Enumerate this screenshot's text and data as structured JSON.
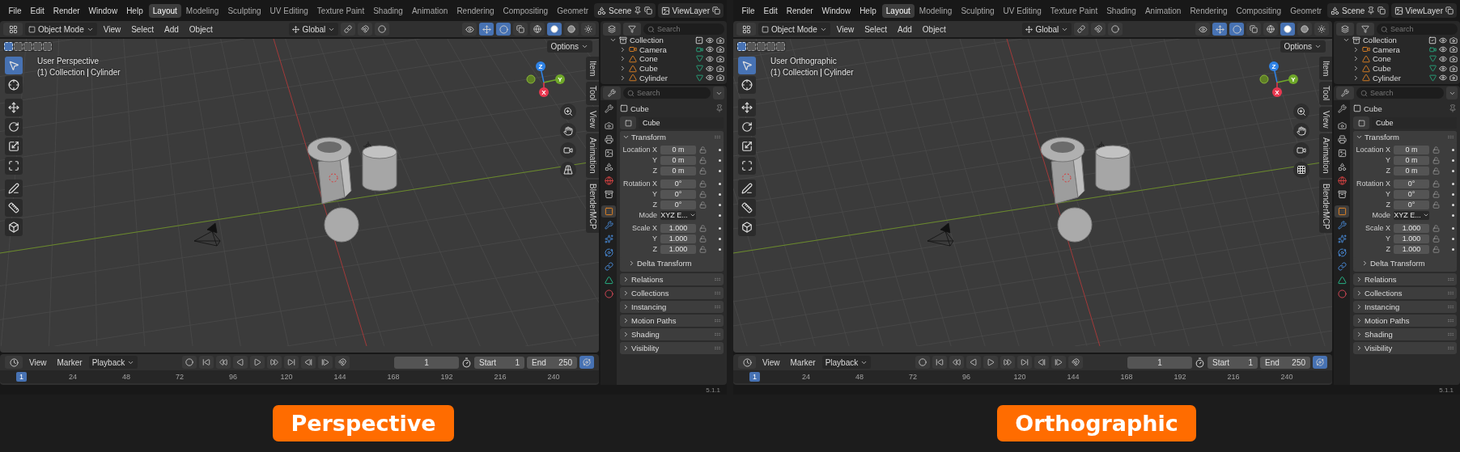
{
  "panels": [
    {
      "caption": "Perspective",
      "menu": [
        "File",
        "Edit",
        "Render",
        "Window",
        "Help"
      ],
      "workspaces": [
        {
          "label": "Layout",
          "selected": true
        },
        {
          "label": "Modeling",
          "selected": false
        },
        {
          "label": "Sculpting",
          "selected": false
        },
        {
          "label": "UV Editing",
          "selected": false
        },
        {
          "label": "Texture Paint",
          "selected": false
        },
        {
          "label": "Shading",
          "selected": false
        },
        {
          "label": "Animation",
          "selected": false
        },
        {
          "label": "Rendering",
          "selected": false
        },
        {
          "label": "Compositing",
          "selected": false
        },
        {
          "label": "Geometr",
          "selected": false
        }
      ],
      "scene": "Scene",
      "view_layer": "ViewLayer",
      "viewport": {
        "kind": "perspective",
        "mode": "Object Mode",
        "menu": [
          "View",
          "Select",
          "Add",
          "Object"
        ],
        "orientation": "Global",
        "options": "Options",
        "view_name": "User Perspective",
        "collection": "(1) Collection",
        "active_object": "Cylinder",
        "tools": [
          {
            "kind": "select",
            "selected": true
          },
          {
            "kind": "cursor",
            "selected": false
          },
          {
            "kind": "move",
            "selected": false
          },
          {
            "kind": "rotate",
            "selected": false
          },
          {
            "kind": "scale",
            "selected": false
          },
          {
            "kind": "transform",
            "selected": false
          },
          {
            "kind": "annotate",
            "selected": false
          },
          {
            "kind": "measure",
            "selected": false
          },
          {
            "kind": "add",
            "selected": false
          }
        ],
        "gizmo_axes": [
          {
            "label": "Z",
            "color": "#2f83e6"
          },
          {
            "label": "Y",
            "color": "#6fa829"
          },
          {
            "label": "X",
            "color": "#e8374f"
          }
        ],
        "side_tabs": [
          "Item",
          "Tool",
          "View",
          "Animation",
          "BlenderMCP"
        ]
      },
      "outliner": {
        "search_placeholder": "Search",
        "items": [
          {
            "name": "Collection",
            "kind": "collection",
            "expanded": true,
            "checked": true,
            "children": [
              {
                "name": "Camera",
                "kind": "camera",
                "expanded": false
              },
              {
                "name": "Cone",
                "kind": "mesh",
                "expanded": false
              },
              {
                "name": "Cube",
                "kind": "mesh",
                "expanded": false
              },
              {
                "name": "Cylinder",
                "kind": "mesh",
                "expanded": false
              }
            ]
          }
        ]
      },
      "properties": {
        "search_placeholder": "Search",
        "object": "Cube",
        "data_name": "Cube",
        "tabs": [
          {
            "kind": "tool",
            "selected": false
          },
          {
            "kind": "render",
            "selected": false
          },
          {
            "kind": "output",
            "selected": false
          },
          {
            "kind": "view_layer",
            "selected": false
          },
          {
            "kind": "scene",
            "selected": false
          },
          {
            "kind": "world",
            "selected": false
          },
          {
            "kind": "collection",
            "selected": false
          },
          {
            "kind": "object",
            "selected": true
          },
          {
            "kind": "modifiers",
            "selected": false
          },
          {
            "kind": "particles",
            "selected": false
          },
          {
            "kind": "physics",
            "selected": false
          },
          {
            "kind": "constraints",
            "selected": false
          },
          {
            "kind": "data",
            "selected": false
          },
          {
            "kind": "material",
            "selected": false
          }
        ],
        "transform": {
          "title": "Transform",
          "expanded": true,
          "groups": [
            {
              "rows": [
                {
                  "kind": "number",
                  "label": "Location X",
                  "value": "0 m"
                },
                {
                  "kind": "number",
                  "label": "Y",
                  "value": "0 m"
                },
                {
                  "kind": "number",
                  "label": "Z",
                  "value": "0 m"
                }
              ]
            },
            {
              "rows": [
                {
                  "kind": "number",
                  "label": "Rotation X",
                  "value": "0°"
                },
                {
                  "kind": "number",
                  "label": "Y",
                  "value": "0°"
                },
                {
                  "kind": "number",
                  "label": "Z",
                  "value": "0°"
                },
                {
                  "kind": "dropdown",
                  "label": "Mode",
                  "value": "XYZ E..."
                }
              ]
            },
            {
              "rows": [
                {
                  "kind": "number",
                  "label": "Scale X",
                  "value": "1.000"
                },
                {
                  "kind": "number",
                  "label": "Y",
                  "value": "1.000"
                },
                {
                  "kind": "number",
                  "label": "Z",
                  "value": "1.000"
                }
              ]
            }
          ],
          "subpanel": {
            "title": "Delta Transform",
            "expanded": false
          }
        },
        "sections": [
          {
            "title": "Relations",
            "expanded": false
          },
          {
            "title": "Collections",
            "expanded": false
          },
          {
            "title": "Instancing",
            "expanded": false
          },
          {
            "title": "Motion Paths",
            "expanded": false
          },
          {
            "title": "Shading",
            "expanded": false
          },
          {
            "title": "Visibility",
            "expanded": false
          }
        ]
      },
      "timeline": {
        "menu": [
          "View",
          "Marker"
        ],
        "playback": "Playback",
        "current_frame": "1",
        "start_label": "Start",
        "start": "1",
        "end_label": "End",
        "end": "250",
        "ruler": [
          {
            "label": "1",
            "selected": true
          },
          {
            "label": "24",
            "selected": false
          },
          {
            "label": "48",
            "selected": false
          },
          {
            "label": "72",
            "selected": false
          },
          {
            "label": "96",
            "selected": false
          },
          {
            "label": "120",
            "selected": false
          },
          {
            "label": "144",
            "selected": false
          },
          {
            "label": "168",
            "selected": false
          },
          {
            "label": "192",
            "selected": false
          },
          {
            "label": "216",
            "selected": false
          },
          {
            "label": "240",
            "selected": false
          }
        ]
      },
      "version": "5.1.1"
    },
    {
      "caption": "Orthographic",
      "menu": [
        "File",
        "Edit",
        "Render",
        "Window",
        "Help"
      ],
      "workspaces": [
        {
          "label": "Layout",
          "selected": true
        },
        {
          "label": "Modeling",
          "selected": false
        },
        {
          "label": "Sculpting",
          "selected": false
        },
        {
          "label": "UV Editing",
          "selected": false
        },
        {
          "label": "Texture Paint",
          "selected": false
        },
        {
          "label": "Shading",
          "selected": false
        },
        {
          "label": "Animation",
          "selected": false
        },
        {
          "label": "Rendering",
          "selected": false
        },
        {
          "label": "Compositing",
          "selected": false
        },
        {
          "label": "Geometr",
          "selected": false
        }
      ],
      "scene": "Scene",
      "view_layer": "ViewLayer",
      "viewport": {
        "kind": "orthographic",
        "mode": "Object Mode",
        "menu": [
          "View",
          "Select",
          "Add",
          "Object"
        ],
        "orientation": "Global",
        "options": "Options",
        "view_name": "User Orthographic",
        "collection": "(1) Collection",
        "active_object": "Cylinder",
        "tools": [
          {
            "kind": "select",
            "selected": true
          },
          {
            "kind": "cursor",
            "selected": false
          },
          {
            "kind": "move",
            "selected": false
          },
          {
            "kind": "rotate",
            "selected": false
          },
          {
            "kind": "scale",
            "selected": false
          },
          {
            "kind": "transform",
            "selected": false
          },
          {
            "kind": "annotate",
            "selected": false
          },
          {
            "kind": "measure",
            "selected": false
          },
          {
            "kind": "add",
            "selected": false
          }
        ],
        "gizmo_axes": [
          {
            "label": "Z",
            "color": "#2f83e6"
          },
          {
            "label": "Y",
            "color": "#6fa829"
          },
          {
            "label": "X",
            "color": "#e8374f"
          }
        ],
        "side_tabs": [
          "Item",
          "Tool",
          "View",
          "Animation",
          "BlenderMCP"
        ]
      },
      "outliner": {
        "search_placeholder": "Search",
        "items": [
          {
            "name": "Collection",
            "kind": "collection",
            "expanded": true,
            "checked": true,
            "children": [
              {
                "name": "Camera",
                "kind": "camera",
                "expanded": false
              },
              {
                "name": "Cone",
                "kind": "mesh",
                "expanded": false
              },
              {
                "name": "Cube",
                "kind": "mesh",
                "expanded": false
              },
              {
                "name": "Cylinder",
                "kind": "mesh",
                "expanded": false
              }
            ]
          }
        ]
      },
      "properties": {
        "search_placeholder": "Search",
        "object": "Cube",
        "data_name": "Cube",
        "tabs": [
          {
            "kind": "tool",
            "selected": false
          },
          {
            "kind": "render",
            "selected": false
          },
          {
            "kind": "output",
            "selected": false
          },
          {
            "kind": "view_layer",
            "selected": false
          },
          {
            "kind": "scene",
            "selected": false
          },
          {
            "kind": "world",
            "selected": false
          },
          {
            "kind": "collection",
            "selected": false
          },
          {
            "kind": "object",
            "selected": true
          },
          {
            "kind": "modifiers",
            "selected": false
          },
          {
            "kind": "particles",
            "selected": false
          },
          {
            "kind": "physics",
            "selected": false
          },
          {
            "kind": "constraints",
            "selected": false
          },
          {
            "kind": "data",
            "selected": false
          },
          {
            "kind": "material",
            "selected": false
          }
        ],
        "transform": {
          "title": "Transform",
          "expanded": true,
          "groups": [
            {
              "rows": [
                {
                  "kind": "number",
                  "label": "Location X",
                  "value": "0 m"
                },
                {
                  "kind": "number",
                  "label": "Y",
                  "value": "0 m"
                },
                {
                  "kind": "number",
                  "label": "Z",
                  "value": "0 m"
                }
              ]
            },
            {
              "rows": [
                {
                  "kind": "number",
                  "label": "Rotation X",
                  "value": "0°"
                },
                {
                  "kind": "number",
                  "label": "Y",
                  "value": "0°"
                },
                {
                  "kind": "number",
                  "label": "Z",
                  "value": "0°"
                },
                {
                  "kind": "dropdown",
                  "label": "Mode",
                  "value": "XYZ E..."
                }
              ]
            },
            {
              "rows": [
                {
                  "kind": "number",
                  "label": "Scale X",
                  "value": "1.000"
                },
                {
                  "kind": "number",
                  "label": "Y",
                  "value": "1.000"
                },
                {
                  "kind": "number",
                  "label": "Z",
                  "value": "1.000"
                }
              ]
            }
          ],
          "subpanel": {
            "title": "Delta Transform",
            "expanded": false
          }
        },
        "sections": [
          {
            "title": "Relations",
            "expanded": false
          },
          {
            "title": "Collections",
            "expanded": false
          },
          {
            "title": "Instancing",
            "expanded": false
          },
          {
            "title": "Motion Paths",
            "expanded": false
          },
          {
            "title": "Shading",
            "expanded": false
          },
          {
            "title": "Visibility",
            "expanded": false
          }
        ]
      },
      "timeline": {
        "menu": [
          "View",
          "Marker"
        ],
        "playback": "Playback",
        "current_frame": "1",
        "start_label": "Start",
        "start": "1",
        "end_label": "End",
        "end": "250",
        "ruler": [
          {
            "label": "1",
            "selected": true
          },
          {
            "label": "24",
            "selected": false
          },
          {
            "label": "48",
            "selected": false
          },
          {
            "label": "72",
            "selected": false
          },
          {
            "label": "96",
            "selected": false
          },
          {
            "label": "120",
            "selected": false
          },
          {
            "label": "144",
            "selected": false
          },
          {
            "label": "168",
            "selected": false
          },
          {
            "label": "192",
            "selected": false
          },
          {
            "label": "216",
            "selected": false
          },
          {
            "label": "240",
            "selected": false
          }
        ]
      },
      "version": "5.1.1"
    }
  ]
}
